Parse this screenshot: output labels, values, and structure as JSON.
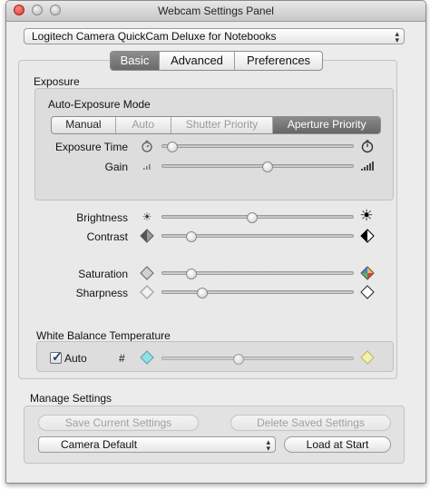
{
  "window": {
    "title": "Webcam Settings Panel"
  },
  "camera_select": {
    "value": "Logitech Camera QuickCam Deluxe for Notebooks"
  },
  "tabs": [
    {
      "label": "Basic",
      "active": true
    },
    {
      "label": "Advanced",
      "active": false
    },
    {
      "label": "Preferences",
      "active": false
    }
  ],
  "exposure": {
    "title": "Exposure",
    "mode_label": "Auto-Exposure Mode",
    "modes": [
      {
        "label": "Manual",
        "active": false
      },
      {
        "label": "Auto",
        "active": false
      },
      {
        "label": "Shutter Priority",
        "active": false
      },
      {
        "label": "Aperture Priority",
        "active": true
      }
    ],
    "exposure_time": {
      "label": "Exposure Time",
      "value": 0.05
    },
    "gain": {
      "label": "Gain",
      "value": 0.55
    }
  },
  "image": {
    "brightness": {
      "label": "Brightness",
      "value": 0.47
    },
    "contrast": {
      "label": "Contrast",
      "value": 0.15
    },
    "saturation": {
      "label": "Saturation",
      "value": 0.15
    },
    "sharpness": {
      "label": "Sharpness",
      "value": 0.21
    }
  },
  "white_balance": {
    "title": "White Balance Temperature",
    "auto_label": "Auto",
    "auto_checked": true,
    "hash_label": "#",
    "value": 0.4
  },
  "manage": {
    "title": "Manage Settings",
    "save_label": "Save Current Settings",
    "delete_label": "Delete Saved Settings",
    "profile_value": "Camera Default",
    "load_label": "Load at Start"
  },
  "colors": {
    "accent_knob": "#ffffff",
    "segment_active": "#6e6e6e",
    "checkmark": "#1d3d8a"
  }
}
